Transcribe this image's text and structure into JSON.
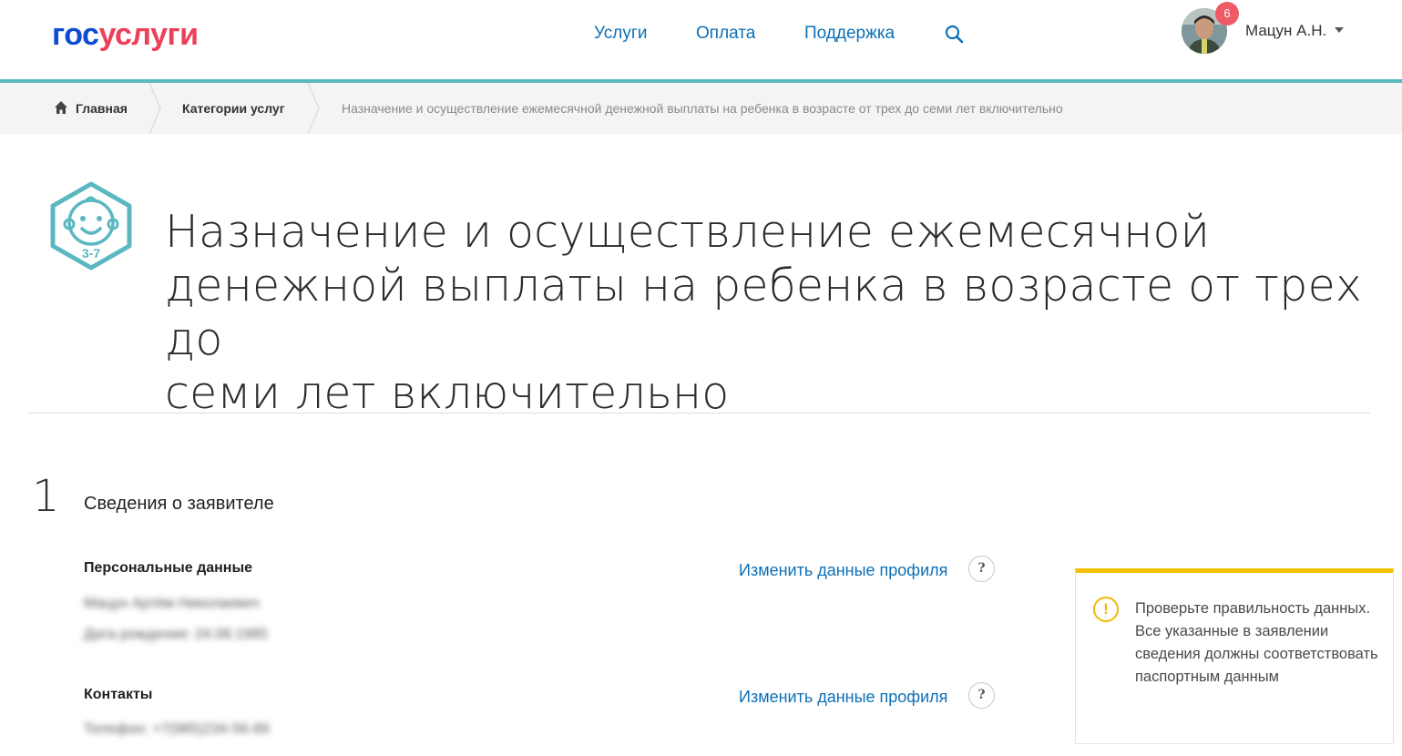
{
  "header": {
    "logo_part1": "гос",
    "logo_part2": "услуги",
    "nav": [
      "Услуги",
      "Оплата",
      "Поддержка"
    ],
    "notifications_count": "6",
    "user_name": "Мацун А.Н."
  },
  "breadcrumbs": {
    "home": "Главная",
    "categories": "Категории услуг",
    "current": "Назначение и осуществление ежемесячной денежной выплаты на ребенка в возрасте от трех до семи лет включительно"
  },
  "service": {
    "icon_label": "3-7",
    "title_lines": [
      "Назначение и осуществление ежемесячной",
      "денежной выплаты на ребенка в возрасте от трех до",
      "семи лет включительно"
    ]
  },
  "step": {
    "number": "1",
    "title": "Сведения о заявителе"
  },
  "personal": {
    "label": "Персональные данные",
    "line1": "Мацун Артём Николаевич",
    "line2": "Дата рождения: 24.08.1985",
    "edit_link": "Изменить данные профиля",
    "help": "?"
  },
  "contacts": {
    "label": "Контакты",
    "line1": "Телефон: +7(985)234-56-89",
    "edit_link": "Изменить данные профиля",
    "help": "?"
  },
  "warning": {
    "icon": "!",
    "text": "Проверьте правильность данных. Все указанные в заявлении сведения должны соответствовать паспортным данным"
  },
  "colors": {
    "brand_blue": "#0d4cd3",
    "brand_red": "#ee3f58",
    "link_blue": "#0d70b6",
    "accent_teal": "#5bb8c1",
    "warning_yellow": "#f2c200"
  }
}
